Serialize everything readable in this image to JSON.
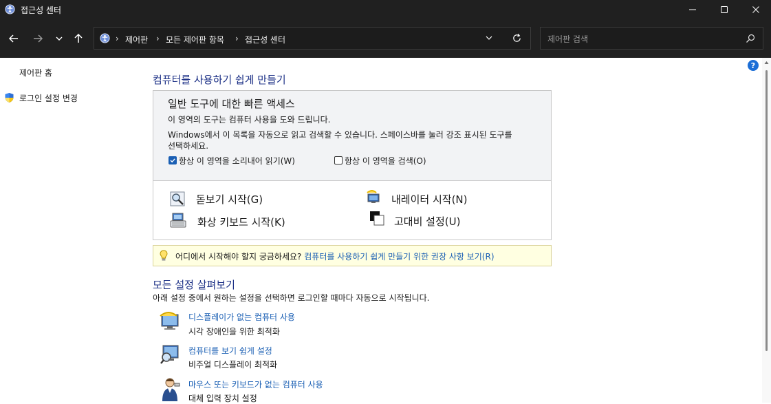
{
  "window": {
    "title": "접근성 센터",
    "icons": {
      "app": "ease-of-access-icon",
      "minimize": "minimize-icon",
      "maximize": "maximize-icon",
      "close": "close-icon"
    }
  },
  "nav": {
    "breadcrumb": [
      "제어판",
      "모든 제어판 항목",
      "접근성 센터"
    ],
    "search_placeholder": "제어판 검색",
    "icons": [
      "back-arrow-icon",
      "forward-arrow-icon",
      "chevron-down-icon",
      "up-arrow-icon",
      "refresh-icon",
      "search-icon"
    ]
  },
  "sidebar": {
    "home": "제어판 홈",
    "login_settings": "로그인 설정 변경"
  },
  "main": {
    "heading": "컴퓨터를 사용하기 쉽게 만들기",
    "quick": {
      "title": "일반 도구에 대한 빠른 액세스",
      "desc1": "이 영역의 도구는 컴퓨터 사용을 도와 드립니다.",
      "desc2_line1": "Windows에서 이 목록을 자동으로 읽고 검색할 수 있습니다. 스페이스바를 눌러 강조 표시된 도구를",
      "desc2_line2": "선택하세요.",
      "read_aloud": {
        "label": "항상 이 영역을 소리내어 읽기(W)",
        "checked": true
      },
      "scan": {
        "label": "항상 이 영역을 검색(O)",
        "checked": false
      },
      "tools": {
        "magnifier": "돋보기 시작(G)",
        "narrator": "내레이터 시작(N)",
        "osk": "화상 키보드 시작(K)",
        "contrast": "고대비 설정(U)"
      }
    },
    "tip": {
      "text": "어디에서 시작해야 할지 궁금하세요?",
      "link": "컴퓨터를 사용하기 쉽게 만들기 위한 권장 사항 보기(R)"
    },
    "explore": {
      "heading": "모든 설정 살펴보기",
      "desc": "아래 설정 중에서 원하는 설정을 선택하면 로그인할 때마다 자동으로 시작됩니다.",
      "items": [
        {
          "link": "디스플레이가 없는 컴퓨터 사용",
          "desc": "시각 장애인을 위한 최적화"
        },
        {
          "link": "컴퓨터를 보기 쉽게 설정",
          "desc": "비주얼 디스플레이 최적화"
        },
        {
          "link": "마우스 또는 키보드가 없는 컴퓨터 사용",
          "desc": "대체 입력 장치 설정"
        }
      ]
    }
  },
  "help": "?"
}
